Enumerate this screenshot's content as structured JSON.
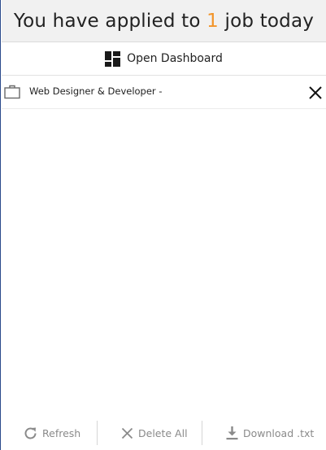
{
  "header": {
    "prefix": "You have applied to",
    "count": "1",
    "suffix": "job today"
  },
  "dashboard": {
    "label": "Open Dashboard",
    "icon": "dashboard-icon"
  },
  "jobs": [
    {
      "title": "Web Designer & Developer -",
      "icon": "briefcase-icon",
      "remove_icon": "close-icon"
    }
  ],
  "footer": {
    "refresh_label": "Refresh",
    "delete_label": "Delete All",
    "download_label": "Download .txt"
  },
  "colors": {
    "accent": "#f2952b",
    "muted": "#8a8a8a",
    "header_bg": "#f1f1f1"
  }
}
